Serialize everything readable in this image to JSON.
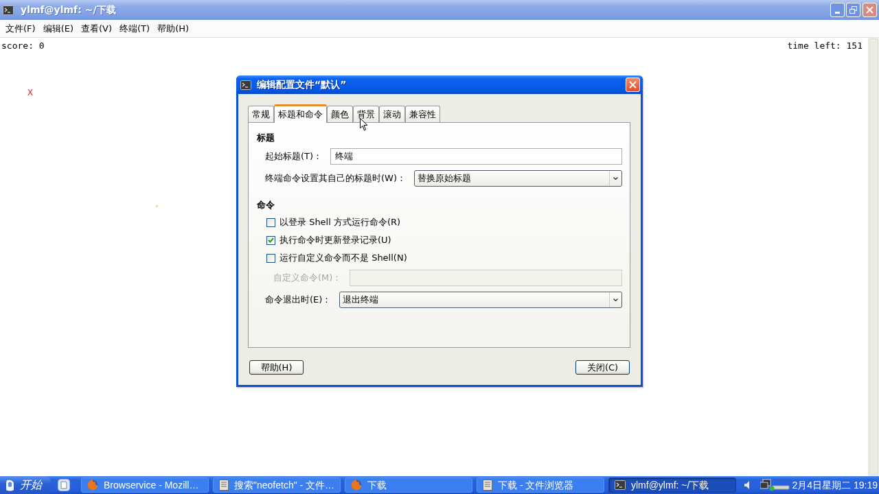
{
  "window": {
    "title": "ylmf@ylmf: ~/下载"
  },
  "menu": [
    "文件(F)",
    "编辑(E)",
    "查看(V)",
    "终端(T)",
    "帮助(H)"
  ],
  "terminal": {
    "score": "score: 0",
    "time_left": "time left: 151",
    "player": "X"
  },
  "dialog": {
    "title": "编辑配置文件“默认”",
    "tabs": [
      {
        "label": "常规",
        "selected": false
      },
      {
        "label": "标题和命令",
        "selected": true
      },
      {
        "label": "颜色",
        "selected": false
      },
      {
        "label": "背景",
        "selected": false
      },
      {
        "label": "滚动",
        "selected": false
      },
      {
        "label": "兼容性",
        "selected": false
      }
    ],
    "sections": [
      {
        "heading": "标题",
        "rows": [
          {
            "kind": "text",
            "label": "起始标题(T)：",
            "value": "终端",
            "disabled": false
          },
          {
            "kind": "select",
            "label": "终端命令设置其自己的标题时(W)：",
            "value": "替换原始标题",
            "disabled": false
          }
        ]
      },
      {
        "heading": "命令",
        "rows": [
          {
            "kind": "checkbox",
            "label": "以登录 Shell 方式运行命令(R)",
            "checked": false,
            "disabled": false
          },
          {
            "kind": "checkbox",
            "label": "执行命令时更新登录记录(U)",
            "checked": true,
            "disabled": false
          },
          {
            "kind": "checkbox",
            "label": "运行自定义命令而不是 Shell(N)",
            "checked": false,
            "disabled": false
          },
          {
            "kind": "text",
            "label": "自定义命令(M)：",
            "disabled": true
          },
          {
            "kind": "select",
            "label": "命令退出时(E)：",
            "value": "退出终端",
            "disabled": false
          }
        ]
      }
    ],
    "buttons": [
      "帮助(H)",
      "关闭(C)"
    ]
  },
  "taskbar": {
    "start": "开始",
    "tasks": [
      {
        "kind": "browser",
        "label": "Browservice - Mozill…",
        "selected": false
      },
      {
        "kind": "files",
        "label": "搜索\"neofetch\" - 文件…",
        "selected": false
      },
      {
        "kind": "browser",
        "label": "下载",
        "selected": false
      },
      {
        "kind": "files",
        "label": "下载 - 文件浏览器",
        "selected": false
      },
      {
        "kind": "terminal",
        "label": "ylmf@ylmf: ~/下载",
        "selected": true
      }
    ],
    "clock": "2月4日星期二 19:19"
  }
}
